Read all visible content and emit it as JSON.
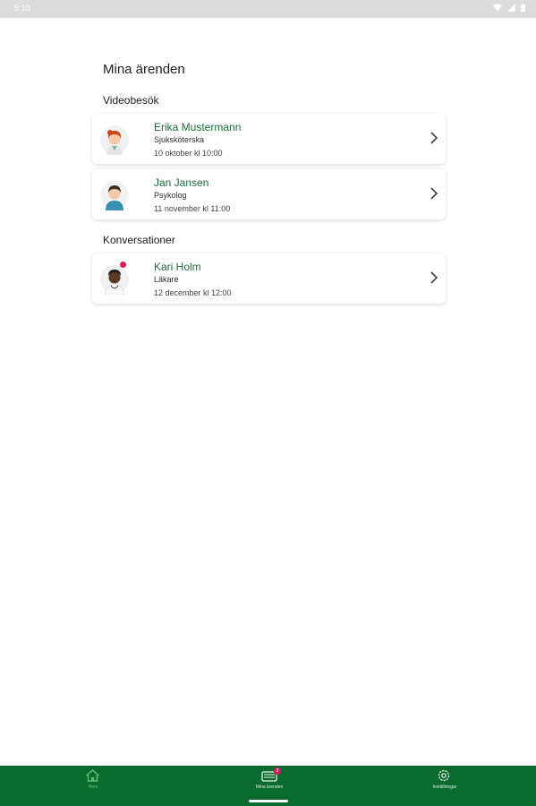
{
  "status_bar": {
    "time": "5:10",
    "icons": [
      "wifi-icon",
      "signal-icon",
      "battery-icon"
    ]
  },
  "page_title": "Mina ärenden",
  "sections": {
    "video": {
      "title": "Videobesök",
      "items": [
        {
          "name": "Erika Mustermann",
          "role": "Sjuksköterska",
          "date": "10 oktober kl 10:00",
          "avatar": "avatar-erika"
        },
        {
          "name": "Jan Jansen",
          "role": "Psykolog",
          "date": "11 november kl 11:00",
          "avatar": "avatar-jan"
        }
      ]
    },
    "conversations": {
      "title": "Konversationer",
      "items": [
        {
          "name": "Kari Holm",
          "role": "Läkare",
          "date": "12 december kl 12:00",
          "avatar": "avatar-kari",
          "unread": true
        }
      ]
    }
  },
  "bottom_nav": {
    "items": [
      {
        "label": "Hem",
        "icon": "home-icon",
        "active": true
      },
      {
        "label": "Mina ärenden",
        "icon": "cases-icon",
        "badge": "2"
      },
      {
        "label": "Inställningar",
        "icon": "settings-icon"
      }
    ]
  },
  "colors": {
    "brand_green": "#0b6b2e",
    "name_green": "#1b6b3a",
    "active_nav": "#62c07e",
    "badge": "#d81b60"
  }
}
